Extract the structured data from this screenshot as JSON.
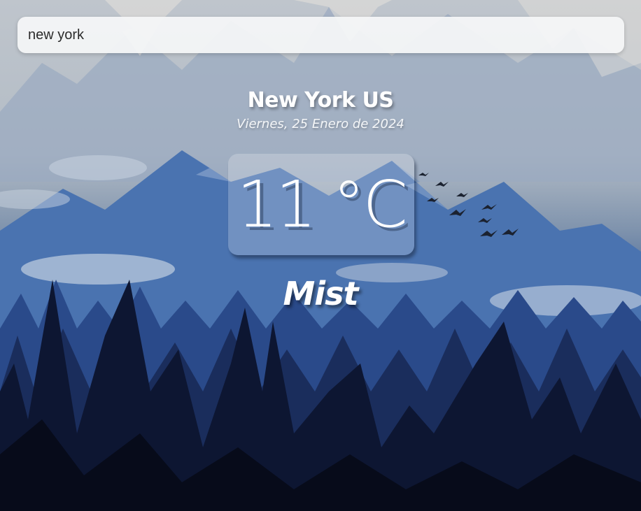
{
  "search": {
    "value": "new york",
    "placeholder": ""
  },
  "weather": {
    "location": "New York US",
    "date": "Viernes, 25 Enero de 2024",
    "temperature": "11 °C",
    "condition": "Mist"
  },
  "background": {
    "scene": "mountain-forest-illustration",
    "colors": {
      "sky": "#bfc5cc",
      "mountain": "#4a73b0",
      "forest": "#1f3766",
      "foreground": "#0c1328"
    }
  }
}
